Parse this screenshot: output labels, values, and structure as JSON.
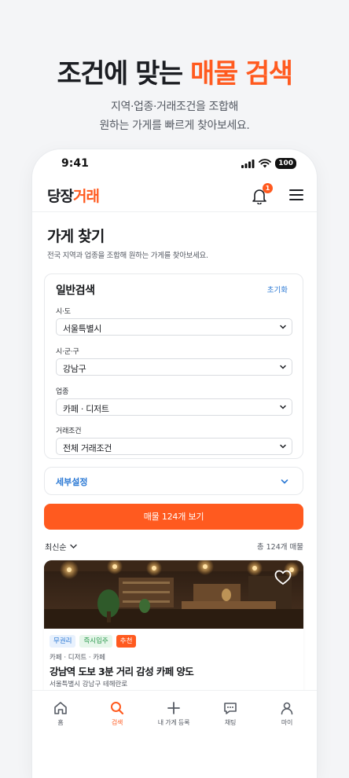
{
  "hero": {
    "title_main": "조건에 맞는 ",
    "title_accent": "매물 검색",
    "subtitle_line1": "지역·업종·거래조건을 조합해",
    "subtitle_line2": "원하는 가게를 빠르게 찾아보세요."
  },
  "status_bar": {
    "time": "9:41",
    "battery": "100"
  },
  "header": {
    "logo_part1": "당장",
    "logo_part2": "거래",
    "notification_count": "1"
  },
  "page": {
    "title": "가게 찾기",
    "description": "전국 지역과 업종을 조합해 원하는 가게를 찾아보세요."
  },
  "filter": {
    "title": "일반검색",
    "reset_label": "초기화",
    "fields": [
      {
        "label": "시·도",
        "value": "서울특별시"
      },
      {
        "label": "시·군·구",
        "value": "강남구"
      },
      {
        "label": "업종",
        "value": "카페 · 디저트"
      },
      {
        "label": "거래조건",
        "value": "전체 거래조건"
      }
    ]
  },
  "detail_settings": {
    "label": "세부설정"
  },
  "cta": {
    "label": "매물 124개 보기"
  },
  "results": {
    "sort_label": "최신순",
    "total_label": "총 124개 매물"
  },
  "listing": {
    "tags": [
      {
        "text": "무권리",
        "style": "blue"
      },
      {
        "text": "즉시입주",
        "style": "green"
      },
      {
        "text": "추천",
        "style": "orange"
      }
    ],
    "category": "카페 · 디저트 · 카페",
    "title": "강남역 도보 3분 거리 감성 카페 양도",
    "address": "서울특별시 강남구 테헤란로"
  },
  "tabbar": {
    "items": [
      {
        "label": "홈",
        "icon": "home-icon"
      },
      {
        "label": "검색",
        "icon": "search-icon",
        "active": true
      },
      {
        "label": "내 가게 등록",
        "icon": "plus-icon"
      },
      {
        "label": "채팅",
        "icon": "chat-icon"
      },
      {
        "label": "마이",
        "icon": "person-icon"
      }
    ]
  },
  "colors": {
    "accent": "#ff5a1f",
    "link_blue": "#2a78d4",
    "text_dark": "#1b1d22"
  }
}
